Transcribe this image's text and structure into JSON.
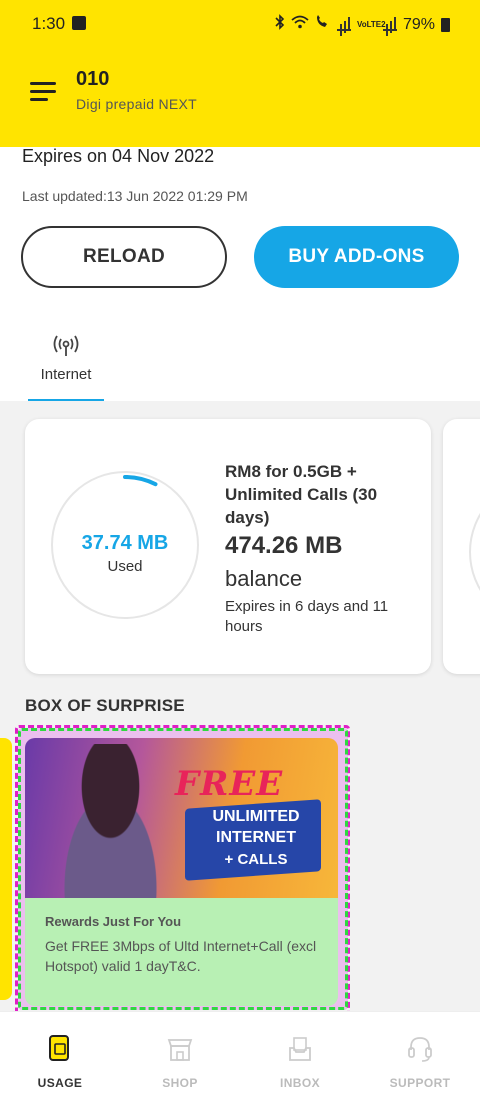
{
  "status_bar": {
    "time": "1:30",
    "battery": "79%",
    "network": "VoLTE2"
  },
  "header": {
    "account_number": "010",
    "plan_name": "Digi prepaid NEXT"
  },
  "account": {
    "expires": "Expires on 04 Nov 2022",
    "last_updated": "Last updated:13 Jun 2022 01:29 PM"
  },
  "actions": {
    "reload_label": "RELOAD",
    "buy_addons_label": "BUY ADD-ONS"
  },
  "tabs": [
    {
      "label": "Internet",
      "icon": "antenna-icon",
      "active": true
    }
  ],
  "usage_card": {
    "used_value": "37.74 MB",
    "used_label": "Used",
    "used_fraction": 0.074,
    "plan": "RM8 for 0.5GB + Unlimited Calls (30 days)",
    "balance_value": "474.26 MB",
    "balance_label": "balance",
    "expires_in": "Expires in 6 days and 11 hours"
  },
  "promo_section": {
    "title": "BOX OF SURPRISE",
    "banner": {
      "free": "FREE",
      "line1": "UNLIMITED",
      "line2": "INTERNET",
      "line3": "+ CALLS"
    },
    "card_title": "Rewards Just For You",
    "card_desc": "Get FREE 3Mbps of Ultd Internet+Call (excl Hotspot) valid 1 dayT&C."
  },
  "bottom_nav": [
    {
      "label": "USAGE",
      "icon": "sim-card-icon",
      "active": true
    },
    {
      "label": "SHOP",
      "icon": "store-icon",
      "active": false
    },
    {
      "label": "INBOX",
      "icon": "inbox-icon",
      "active": false
    },
    {
      "label": "SUPPORT",
      "icon": "headset-icon",
      "active": false
    }
  ],
  "colors": {
    "brand_yellow": "#ffe400",
    "accent_blue": "#16a6e6"
  }
}
